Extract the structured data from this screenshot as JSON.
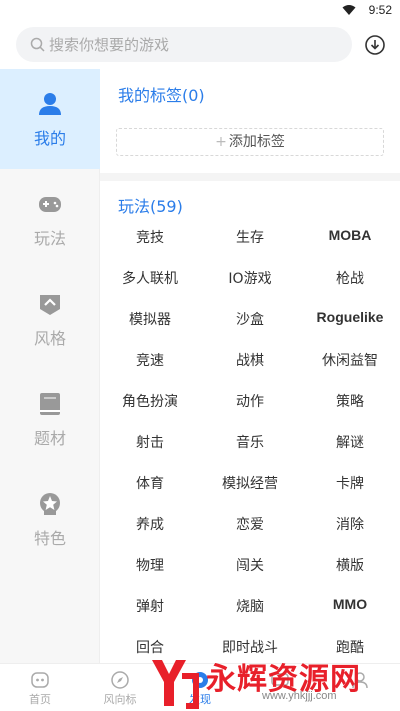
{
  "status": {
    "time": "9:52"
  },
  "search": {
    "placeholder": "搜索你想要的游戏"
  },
  "sidebar": {
    "items": [
      {
        "label": "我的",
        "icon": "person-icon",
        "active": true
      },
      {
        "label": "玩法",
        "icon": "gamepad-icon"
      },
      {
        "label": "风格",
        "icon": "style-icon"
      },
      {
        "label": "题材",
        "icon": "book-icon"
      },
      {
        "label": "特色",
        "icon": "badge-icon"
      }
    ]
  },
  "my_tags": {
    "title": "我的标签(0)",
    "add_label": "添加标签"
  },
  "gameplay": {
    "title": "玩法(59)",
    "tags": [
      "竞技",
      "生存",
      "MOBA",
      "多人联机",
      "IO游戏",
      "枪战",
      "模拟器",
      "沙盒",
      "Roguelike",
      "竞速",
      "战棋",
      "休闲益智",
      "角色扮演",
      "动作",
      "策略",
      "射击",
      "音乐",
      "解谜",
      "体育",
      "模拟经营",
      "卡牌",
      "养成",
      "恋爱",
      "消除",
      "物理",
      "闯关",
      "横版",
      "弹射",
      "烧脑",
      "MMO",
      "回合",
      "即时战斗",
      "跑酷"
    ]
  },
  "tabbar": {
    "items": [
      {
        "label": "首页",
        "icon": "home-icon"
      },
      {
        "label": "风向标",
        "icon": "compass-icon"
      },
      {
        "label": "发现",
        "icon": "discover-icon",
        "active": true
      },
      {
        "label": "",
        "icon": "message-icon"
      },
      {
        "label": "",
        "icon": "profile-icon"
      }
    ]
  },
  "watermark": {
    "text": "永辉资源网",
    "url": "www.yhkjjj.com"
  },
  "colors": {
    "accent": "#2b7de9",
    "sidebar_active_bg": "#dcefff",
    "watermark_red": "#e8202a"
  }
}
